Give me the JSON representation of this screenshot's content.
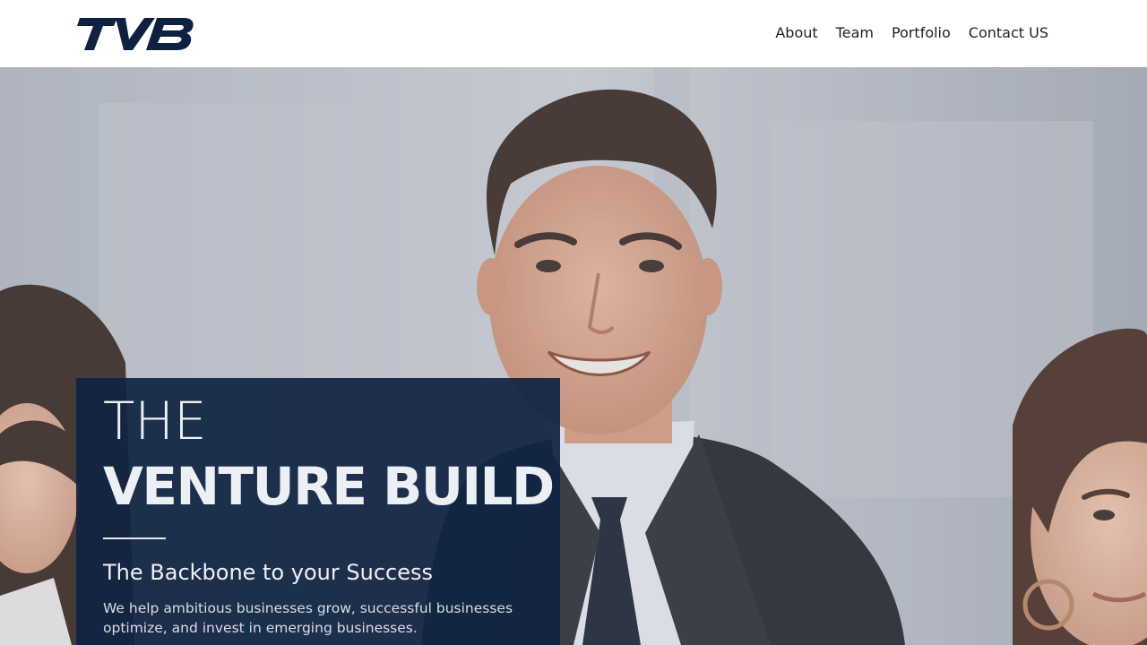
{
  "header": {
    "logo_text": "TVB",
    "nav": [
      {
        "label": "About"
      },
      {
        "label": "Team"
      },
      {
        "label": "Portfolio"
      },
      {
        "label": "Contact US"
      }
    ]
  },
  "hero": {
    "kicker": "THE",
    "title": "VENTURE BUILD",
    "subtitle": "The Backbone to your Success",
    "body": "We help ambitious businesses grow, successful businesses optimize, and invest in emerging businesses.",
    "image_description_icon": "team-photo"
  },
  "colors": {
    "brand_navy": "#0f2140",
    "card_overlay": "#102342",
    "nav_text": "#1b1f2a"
  }
}
